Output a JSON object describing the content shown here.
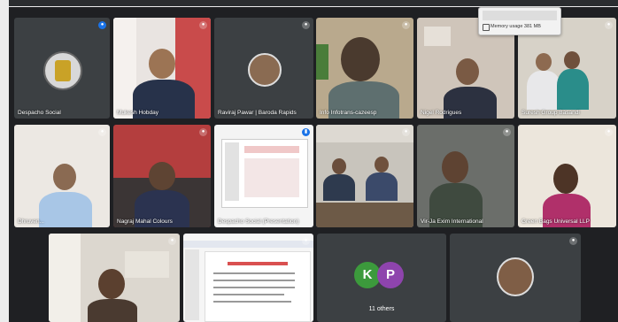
{
  "participants": [
    {
      "name": "Despacho Social",
      "mic": "active",
      "kind": "logo"
    },
    {
      "name": "Mukesh Hobday",
      "mic": "muted",
      "kind": "video"
    },
    {
      "name": "Raviraj Pawar | Baroda Rapids",
      "mic": "muted",
      "kind": "photo"
    },
    {
      "name": "Info Infotrans-cazeesp",
      "mic": "muted",
      "kind": "video"
    },
    {
      "name": "Nigel Rodrigues",
      "mic": "muted",
      "kind": "video"
    },
    {
      "name": "Suresh Group Basandi",
      "mic": "muted",
      "kind": "video"
    },
    {
      "name": "Dhruven...",
      "mic": "muted",
      "kind": "video"
    },
    {
      "name": "Nagraj Mahal Colours",
      "mic": "muted",
      "kind": "video"
    },
    {
      "name": "Despacho Social (Presentation)",
      "mic": "speaking",
      "kind": "presentation"
    },
    {
      "name": "",
      "mic": "muted",
      "kind": "video"
    },
    {
      "name": "Vir-Ja Exim International",
      "mic": "muted",
      "kind": "video"
    },
    {
      "name": "Green Bags Universal LLP",
      "mic": "muted",
      "kind": "video"
    },
    {
      "name": "",
      "mic": "muted",
      "kind": "video"
    },
    {
      "name": "",
      "mic": "muted",
      "kind": "presentation"
    },
    {
      "name": "11 others",
      "mic": "muted",
      "kind": "others"
    },
    {
      "name": "",
      "mic": "muted",
      "kind": "photo"
    }
  ],
  "others": {
    "initials": [
      "K",
      "P"
    ],
    "label": "11 others"
  },
  "tooltip": {
    "text": "Memory usage 381 MB"
  },
  "colors": {
    "accent": "#1a73e8",
    "avatar_k": "#3c9a3c",
    "avatar_p": "#8e44ad"
  }
}
